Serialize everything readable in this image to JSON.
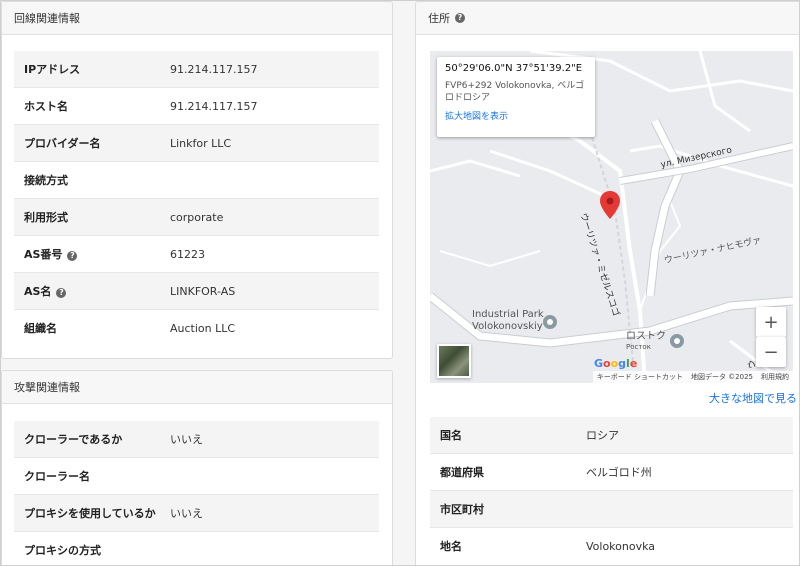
{
  "line_panel": {
    "title": "回線関連情報",
    "rows": [
      {
        "key": "IPアドレス",
        "value": "91.214.117.157",
        "help": false
      },
      {
        "key": "ホスト名",
        "value": "91.214.117.157",
        "help": false
      },
      {
        "key": "プロバイダー名",
        "value": "Linkfor LLC",
        "help": false
      },
      {
        "key": "接続方式",
        "value": "",
        "help": false
      },
      {
        "key": "利用形式",
        "value": "corporate",
        "help": false
      },
      {
        "key": "AS番号",
        "value": "61223",
        "help": true
      },
      {
        "key": "AS名",
        "value": "LINKFOR-AS",
        "help": true
      },
      {
        "key": "組織名",
        "value": "Auction LLC",
        "help": false
      }
    ]
  },
  "attack_panel": {
    "title": "攻撃関連情報",
    "rows": [
      {
        "key": "クローラーであるか",
        "value": "いいえ"
      },
      {
        "key": "クローラー名",
        "value": ""
      },
      {
        "key": "プロキシを使用しているか",
        "value": "いいえ"
      },
      {
        "key": "プロキシの方式",
        "value": ""
      }
    ]
  },
  "address_panel": {
    "title": "住所",
    "help_glyph": "?",
    "map": {
      "coords": "50°29'06.0\"N 37°51'39.2\"E",
      "plus_code": "FVP6+292 Volokonovka, ベルゴロドロシア",
      "enlarge_link": "拡大地図を表示",
      "labels": {
        "street1": "ул. Мизерского",
        "street2": "ウーリツァ・ミゼルスコゴ",
        "street3": "ウーリツァ・ナヒモヴァ",
        "industrial1": "Industrial Park",
        "industrial2": "Volokonovskiy",
        "rostok_jp": "ロストク",
        "rostok_ru": "Росток",
        "edge": "ウ"
      },
      "zoom_in": "+",
      "zoom_out": "−",
      "google": [
        "G",
        "o",
        "o",
        "g",
        "l",
        "e"
      ],
      "attribution": [
        "キーボード ショートカット",
        "地図データ ©2025",
        "利用規約"
      ]
    },
    "big_map_link": "大きな地図で見る",
    "rows": [
      {
        "key": "国名",
        "value": "ロシア"
      },
      {
        "key": "都道府県",
        "value": "ベルゴロド州"
      },
      {
        "key": "市区町村",
        "value": ""
      },
      {
        "key": "地名",
        "value": "Volokonovka"
      }
    ]
  },
  "colors": {
    "link": "#1a73e8",
    "marker": "#e53935",
    "road": "#ffffff",
    "map_bg": "#e9ebee"
  }
}
